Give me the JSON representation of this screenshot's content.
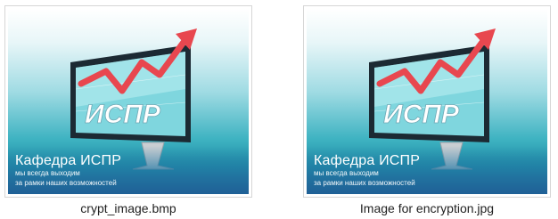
{
  "files": [
    {
      "filename": "crypt_image.bmp",
      "thumbnail": {
        "logo_text": "ИСПР",
        "caption_title": "Кафедра ИСПР",
        "caption_line1": "мы всегда выходим",
        "caption_line2": "за рамки наших возможностей"
      }
    },
    {
      "filename": "Image for encryption.jpg",
      "thumbnail": {
        "logo_text": "ИСПР",
        "caption_title": "Кафедра ИСПР",
        "caption_line1": "мы всегда выходим",
        "caption_line2": "за рамки наших возможностей"
      }
    }
  ],
  "colors": {
    "arrow": "#e8474f",
    "monitor_frame": "#1c2a33",
    "screen": "#7fd6de"
  }
}
